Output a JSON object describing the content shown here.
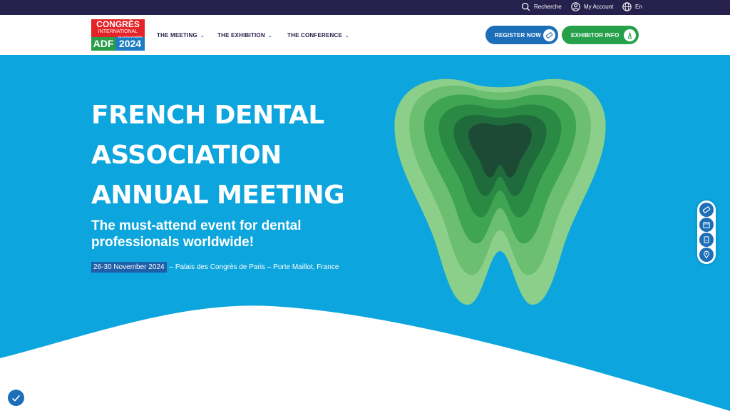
{
  "topbar": {
    "search_label": "Recherche",
    "account_label": "My Account",
    "language_label": "En"
  },
  "logo": {
    "line1": "CONGRÈS",
    "line2": "INTERNATIONAL",
    "dates": "26-30 NOVEMBRE",
    "org": "ADF",
    "year": "2024"
  },
  "nav": {
    "items": [
      {
        "label": "THE MEETING",
        "icon": "chevron-down-icon"
      },
      {
        "label": "THE EXHIBITION",
        "icon": "chevron-down-icon"
      },
      {
        "label": "THE CONFERENCE",
        "icon": "chevron-down-icon"
      }
    ],
    "register_label": "REGISTER NOW",
    "exhibitor_label": "EXHIBITOR INFO"
  },
  "hero": {
    "title_lines": [
      "FRENCH DENTAL",
      "ASSOCIATION",
      "ANNUAL MEETING"
    ],
    "subtitle": "The must-attend event for dental professionals worldwide!",
    "date": "26-30 November 2024",
    "location": "– Palais des Congrès de Paris – Porte Maillot, France"
  },
  "side_tools": [
    "ticket-icon",
    "calendar-icon",
    "badge-icon",
    "map-pin-icon"
  ],
  "colors": {
    "topbar": "#26204d",
    "hero_bg": "#0ca5dd",
    "primary_blue": "#1d6eb8",
    "green": "#26a04a",
    "logo_red": "#e42328"
  }
}
